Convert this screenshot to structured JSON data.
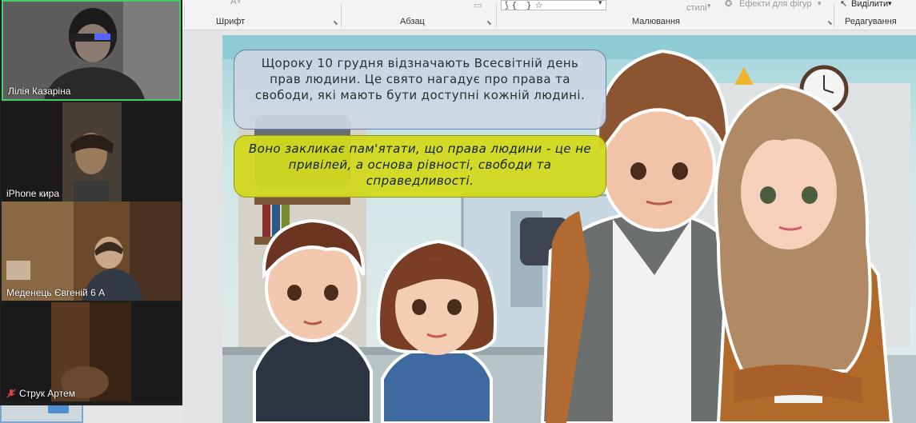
{
  "ribbon": {
    "font_group": "Шрифт",
    "paragraph_group": "Абзац",
    "drawing_group": "Малювання",
    "editing_group": "Редагування",
    "styles_label": "стилі",
    "shape_effects": "Ефекти для фігур",
    "select_label": "Виділити"
  },
  "participants": [
    {
      "name": "Лілія Казаріна",
      "active": true,
      "muted": false
    },
    {
      "name": "iPhone кира",
      "active": false,
      "muted": false
    },
    {
      "name": "Меденець Євгеній 6 А",
      "active": false,
      "muted": false
    },
    {
      "name": "Струк Артем",
      "active": false,
      "muted": true
    }
  ],
  "slide": {
    "callout_1": "Щороку 10 грудня відзначають Всесвітній день прав людини. Це свято нагадує про права та свободи, які мають бути доступні кожній людині.",
    "callout_2": "Воно закликає пам'ятати, що права людини - це не привілей, а основа рівності, свободи та справедливості."
  },
  "colors": {
    "active_border": "#3ecf6c",
    "callout_1_bg": "#cdd6e4",
    "callout_2_bg": "#d2d81c"
  }
}
